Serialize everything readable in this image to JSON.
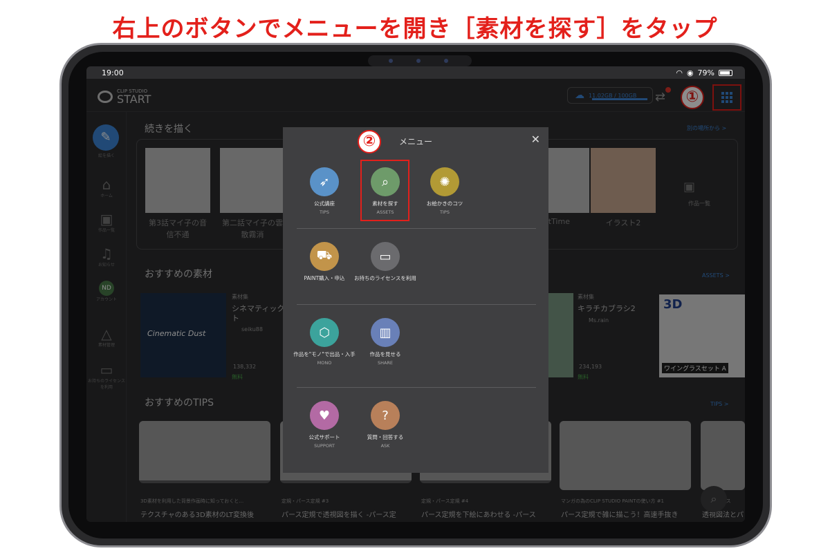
{
  "instruction": "右上のボタンでメニューを開き［素材を探す］をタップ",
  "status_bar": {
    "time": "19:00",
    "battery": "79%"
  },
  "app": {
    "logo_small": "CLIP STUDIO",
    "logo_big": "START",
    "storage": "11.02GB / 100GB"
  },
  "step_markers": {
    "one": "①",
    "two": "②"
  },
  "sidebar": [
    {
      "label": "絵を描く",
      "icon": "brush-icon"
    },
    {
      "label": "ホーム",
      "icon": "home-icon"
    },
    {
      "label": "作品一覧",
      "icon": "gallery-icon"
    },
    {
      "label": "お知らせ",
      "icon": "bell-icon"
    },
    {
      "label": "アカウント",
      "icon": "account-icon",
      "badge": "ND"
    },
    {
      "label": "素材管理",
      "icon": "shapes-icon"
    },
    {
      "label": "お持ちのライセンスを利用",
      "icon": "ticket-icon"
    }
  ],
  "continue_section": {
    "title": "続きを描く",
    "link": "別の場所から >",
    "items": [
      {
        "label1": "第3話マイ子の音",
        "label2": "信不通"
      },
      {
        "label1": "第二話マイ子の雲",
        "label2": "散霧消"
      },
      {
        "label1": "atTime",
        "label2": ""
      },
      {
        "label1": "イラスト2",
        "label2": ""
      },
      {
        "label1": "作品一覧",
        "label2": ""
      }
    ]
  },
  "assets_section": {
    "title": "おすすめの素材",
    "link": "ASSETS >",
    "left": {
      "category": "素材集",
      "name": "シネマティック",
      "name2": "ト",
      "user": "seiku88",
      "downloads": "138,332",
      "price": "無料",
      "cover": "Cinematic Dust"
    },
    "right": {
      "category": "素材集",
      "name": "キラチカブラシ2",
      "user": "Ms.rain",
      "downloads": "234,193",
      "price": "無料"
    },
    "far": {
      "cover_title": "3D",
      "cover_caption": "ワイングラスセット A"
    }
  },
  "tips_section": {
    "title": "おすすめのTIPS",
    "link": "TIPS >",
    "cards": [
      {
        "label": "3D素材を利用した背景作画時に知っておくと…",
        "title": "テクスチャのある3D素材のLT変換後"
      },
      {
        "label": "定規・パース定規 #3",
        "title": "パース定規で透視図を描く -パース定"
      },
      {
        "label": "定規・パース定規 #4",
        "title": "パース定規を下絵にあわせる -パース"
      },
      {
        "label": "マンガの為のCLIP STUDIO PAINTの使い方 #1",
        "title": "パース定規で雑に描こう！高速手抜き"
      },
      {
        "label": "定規・パース",
        "title": "透視図法とパ"
      }
    ]
  },
  "menu": {
    "title": "メニュー",
    "groups": [
      [
        {
          "label": "公式講座",
          "sub": "TIPS",
          "icon": "rocket-icon",
          "color": "#5a92c8"
        },
        {
          "label": "素材を探す",
          "sub": "ASSETS",
          "icon": "search-document-icon",
          "color": "#6e9b6a"
        },
        {
          "label": "お絵かきのコツ",
          "sub": "TIPS",
          "icon": "lightbulb-icon",
          "color": "#b29a35"
        }
      ],
      [
        {
          "label": "PAINT購入・申込",
          "sub": "",
          "icon": "cart-icon",
          "color": "#c2944a"
        },
        {
          "label": "お持ちのライセンスを利用",
          "sub": "",
          "icon": "ticket-icon",
          "color": "#6b6b6e"
        }
      ],
      [
        {
          "label": "作品を\"モノ\"で出品・入手",
          "sub": "MONO",
          "icon": "box-icon",
          "color": "#3ca39c"
        },
        {
          "label": "作品を見せる",
          "sub": "SHARE",
          "icon": "share-book-icon",
          "color": "#6980b8"
        }
      ],
      [
        {
          "label": "公式サポート",
          "sub": "SUPPORT",
          "icon": "heart-hand-icon",
          "color": "#b36aa4"
        },
        {
          "label": "質問・回答する",
          "sub": "ASK",
          "icon": "question-icon",
          "color": "#b8805a"
        }
      ]
    ]
  }
}
